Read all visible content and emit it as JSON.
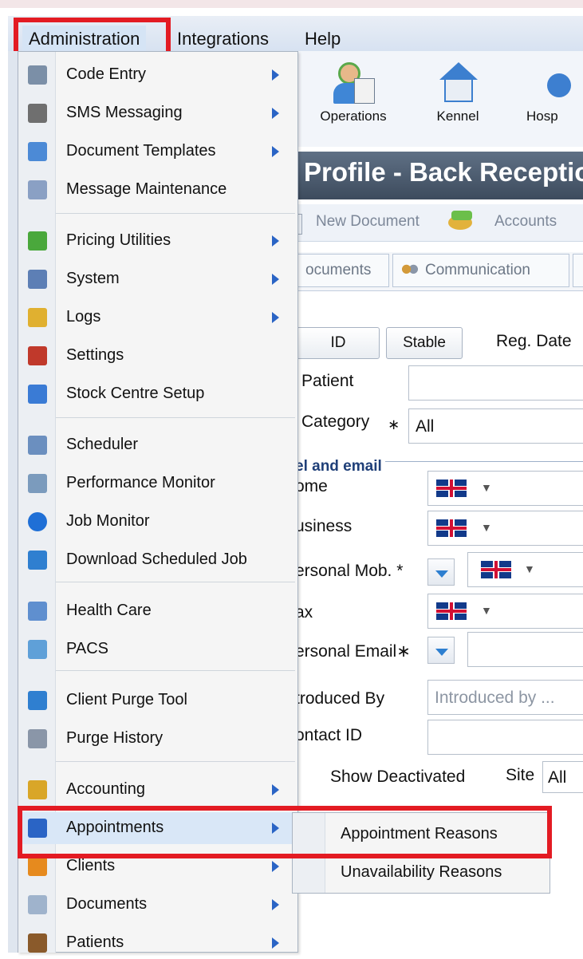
{
  "menubar": {
    "items": [
      "Administration",
      "Integrations",
      "Help"
    ]
  },
  "toolbar": {
    "buttons": [
      "Operations",
      "Kennel",
      "Hosp"
    ]
  },
  "title": "Profile - Back Receptio",
  "actions": {
    "new_document": "New Document",
    "accounts": "Accounts"
  },
  "tabs": [
    "ocuments",
    "Communication"
  ],
  "form": {
    "id_button": "ID",
    "stable_button": "Stable",
    "reg_date_label": "Reg. Date",
    "patient_label": "Patient",
    "category_label": "Category",
    "category_required": "∗",
    "category_value": "All",
    "fieldset_legend": "el and email",
    "home_label": "ome",
    "business_label": "usiness",
    "personal_mob_label": "ersonal Mob. *",
    "fax_label": "ax",
    "personal_email_label": "ersonal Email∗",
    "introduced_by_label": "troduced By",
    "introduced_by_placeholder": "Introduced by ...",
    "contact_id_label": "ontact ID",
    "show_deactivated_label": "Show Deactivated",
    "site_label": "Site",
    "site_value": "All"
  },
  "menu": {
    "items": [
      {
        "label": "Code Entry",
        "icon": "code-entry-icon",
        "submenu": true
      },
      {
        "label": "SMS Messaging",
        "icon": "phone-icon",
        "submenu": true
      },
      {
        "label": "Document Templates",
        "icon": "document-template-icon",
        "submenu": true
      },
      {
        "label": "Message Maintenance",
        "icon": "message-icon",
        "submenu": false
      },
      {
        "label": "Pricing Utilities",
        "icon": "pricing-icon",
        "submenu": true
      },
      {
        "label": "System",
        "icon": "system-icon",
        "submenu": true
      },
      {
        "label": "Logs",
        "icon": "logs-icon",
        "submenu": true
      },
      {
        "label": "Settings",
        "icon": "settings-icon",
        "submenu": false
      },
      {
        "label": "Stock Centre Setup",
        "icon": "stock-icon",
        "submenu": false
      },
      {
        "label": "Scheduler",
        "icon": "scheduler-icon",
        "submenu": false
      },
      {
        "label": "Performance Monitor",
        "icon": "gear-icon",
        "submenu": false
      },
      {
        "label": "Job Monitor",
        "icon": "info-icon",
        "submenu": false
      },
      {
        "label": "Download Scheduled Job",
        "icon": "clock-icon",
        "submenu": false
      },
      {
        "label": "Health Care",
        "icon": "health-care-icon",
        "submenu": false
      },
      {
        "label": "PACS",
        "icon": "pacs-icon",
        "submenu": false
      },
      {
        "label": "Client Purge Tool",
        "icon": "purge-tool-icon",
        "submenu": false
      },
      {
        "label": "Purge History",
        "icon": "purge-history-icon",
        "submenu": false
      },
      {
        "label": "Accounting",
        "icon": "accounting-icon",
        "submenu": true
      },
      {
        "label": "Appointments",
        "icon": "calendar-icon",
        "submenu": true
      },
      {
        "label": "Clients",
        "icon": "clients-icon",
        "submenu": true
      },
      {
        "label": "Documents",
        "icon": "document-icon",
        "submenu": true
      },
      {
        "label": "Patients",
        "icon": "horse-icon",
        "submenu": true
      }
    ]
  },
  "submenu": {
    "items": [
      "Appointment Reasons",
      "Unavailability Reasons"
    ]
  },
  "colors": {
    "highlight_border": "#e31b23",
    "menu_arrow": "#2a64c5",
    "title_band": "#4a596c"
  }
}
